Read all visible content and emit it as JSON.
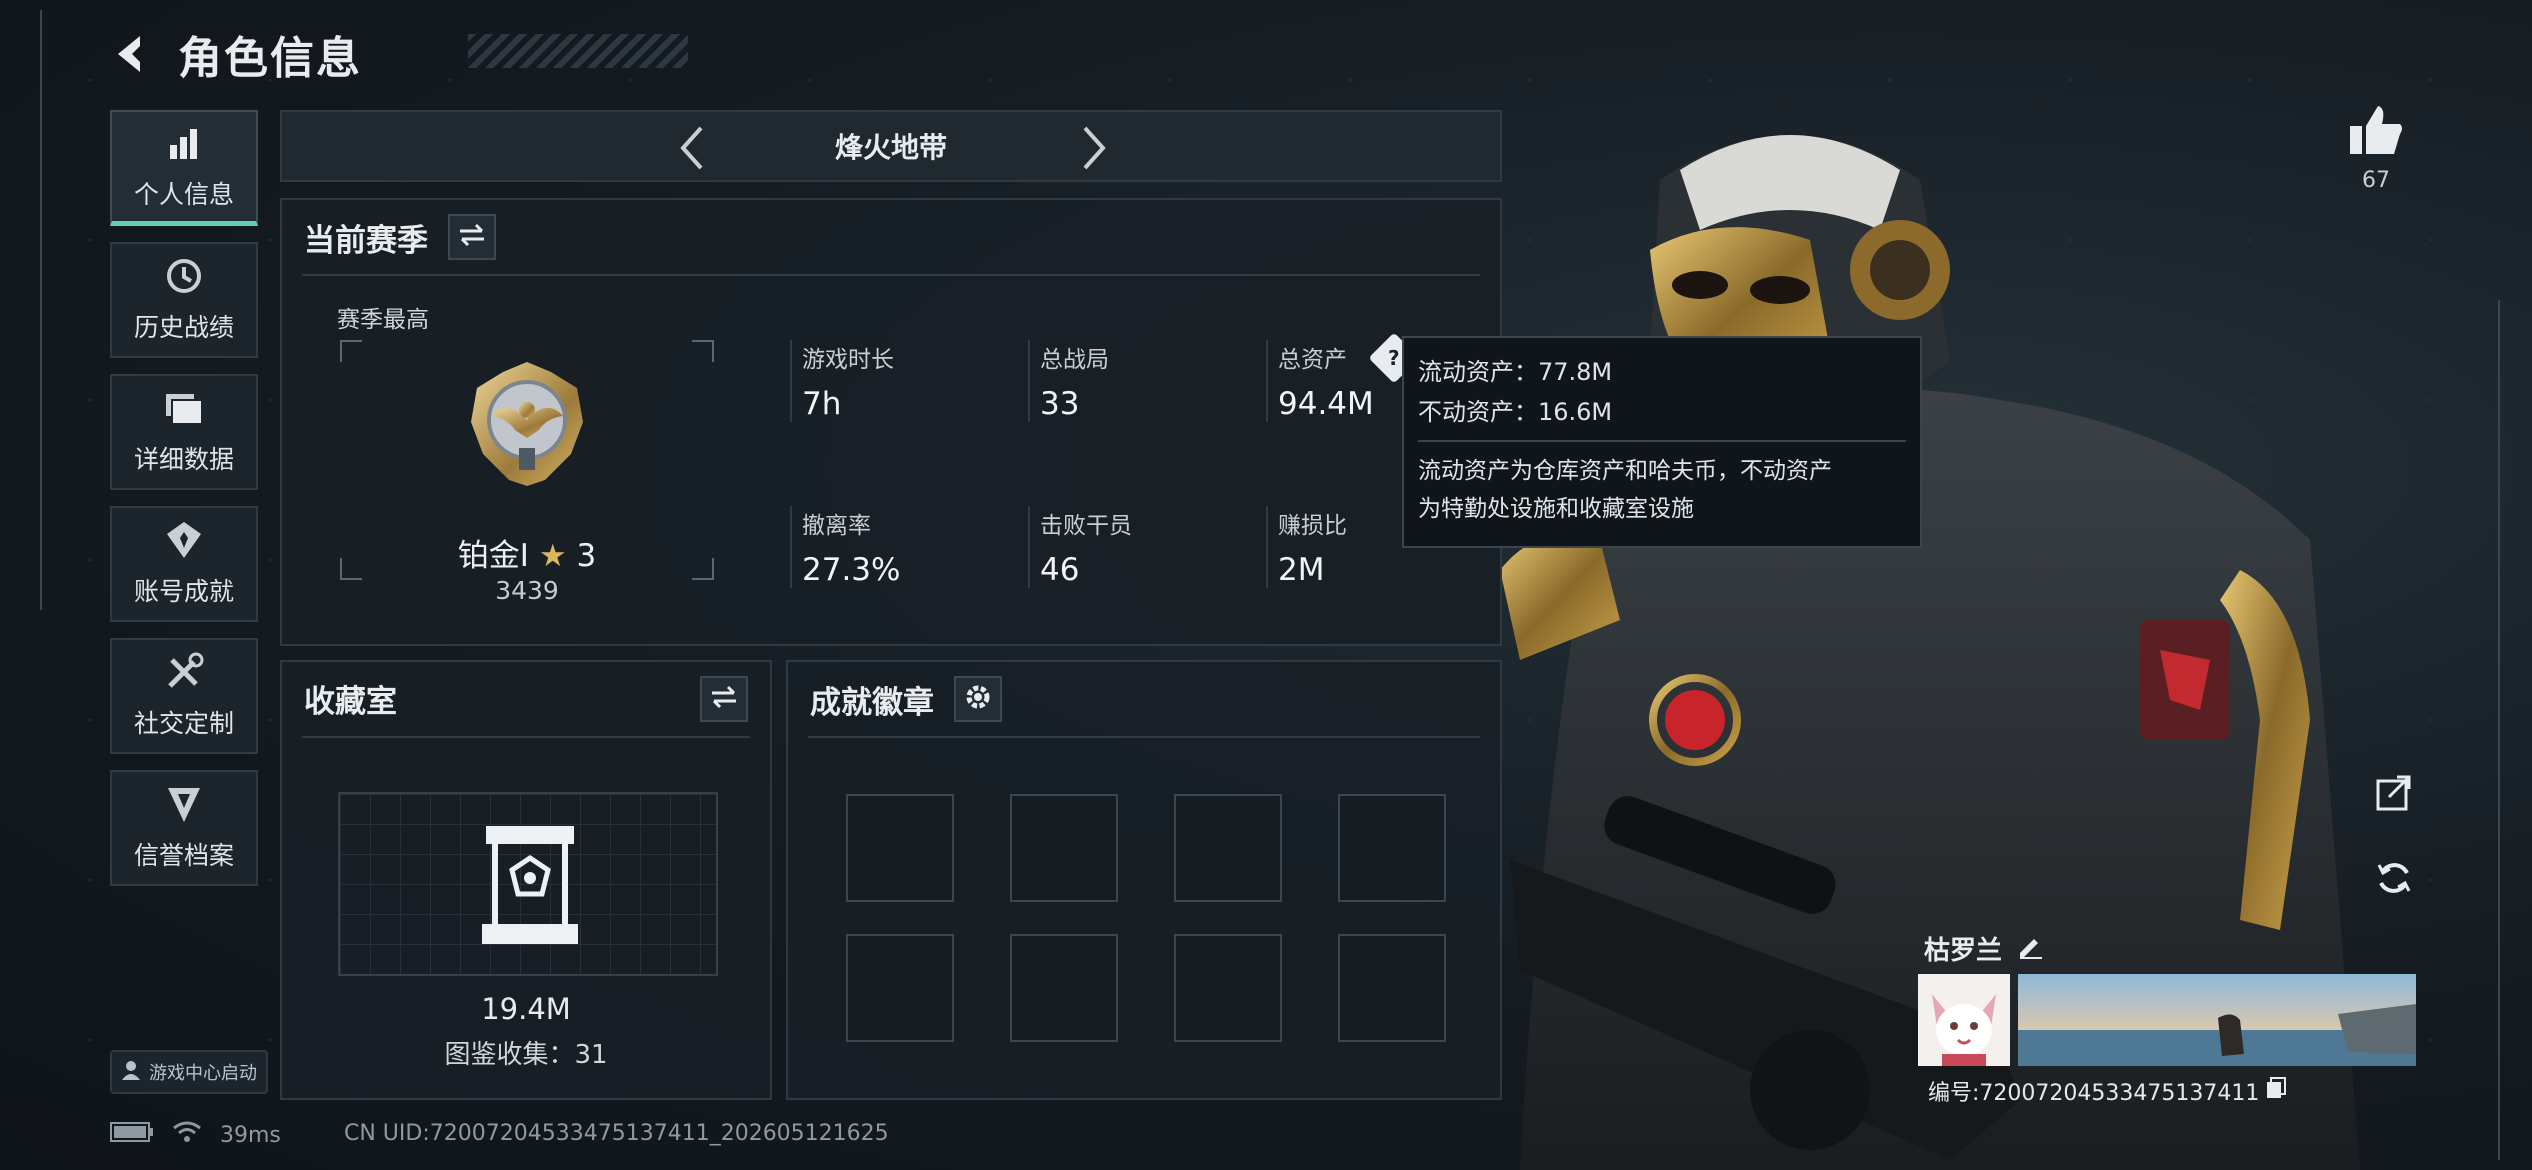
{
  "header": {
    "title": "角色信息"
  },
  "nav": {
    "items": [
      {
        "label": "个人信息",
        "icon": "bar-chart-icon",
        "active": true
      },
      {
        "label": "历史战绩",
        "icon": "history-icon",
        "active": false
      },
      {
        "label": "详细数据",
        "icon": "folder-icon",
        "active": false
      },
      {
        "label": "账号成就",
        "icon": "achievement-icon",
        "active": false
      },
      {
        "label": "社交定制",
        "icon": "tools-icon",
        "active": false
      },
      {
        "label": "信誉档案",
        "icon": "shield-icon",
        "active": false
      }
    ],
    "game_center": "游戏中心启动"
  },
  "mode": {
    "title": "烽火地带"
  },
  "season": {
    "title": "当前赛季",
    "best_label": "赛季最高",
    "rank_name": "铂金Ⅰ",
    "rank_stars": "3",
    "rank_score": "3439",
    "stats": [
      {
        "label": "游戏时长",
        "value": "7h"
      },
      {
        "label": "总战局",
        "value": "33"
      },
      {
        "label": "总资产",
        "value": "94.4M"
      },
      {
        "label": "撤离率",
        "value": "27.3%"
      },
      {
        "label": "击败干员",
        "value": "46"
      },
      {
        "label": "赚损比",
        "value": "2M"
      }
    ]
  },
  "tooltip": {
    "liquid": "流动资产：77.8M",
    "fixed": "不动资产：16.6M",
    "note_line1": "流动资产为仓库资产和哈夫币，不动资产",
    "note_line2": "为特勤处设施和收藏室设施"
  },
  "collection": {
    "title": "收藏室",
    "value": "19.4M",
    "count": "图鉴收集：31"
  },
  "badges": {
    "title": "成就徽章"
  },
  "status": {
    "ping": "39ms",
    "uid": "CN UID:72007204533475137411_202605121625"
  },
  "player": {
    "likes": "67",
    "name": "枯罗兰",
    "id": "编号:72007204533475137411"
  },
  "colors": {
    "accent": "#5fd3b1",
    "panel": "#182026",
    "border": "#2d3943"
  }
}
